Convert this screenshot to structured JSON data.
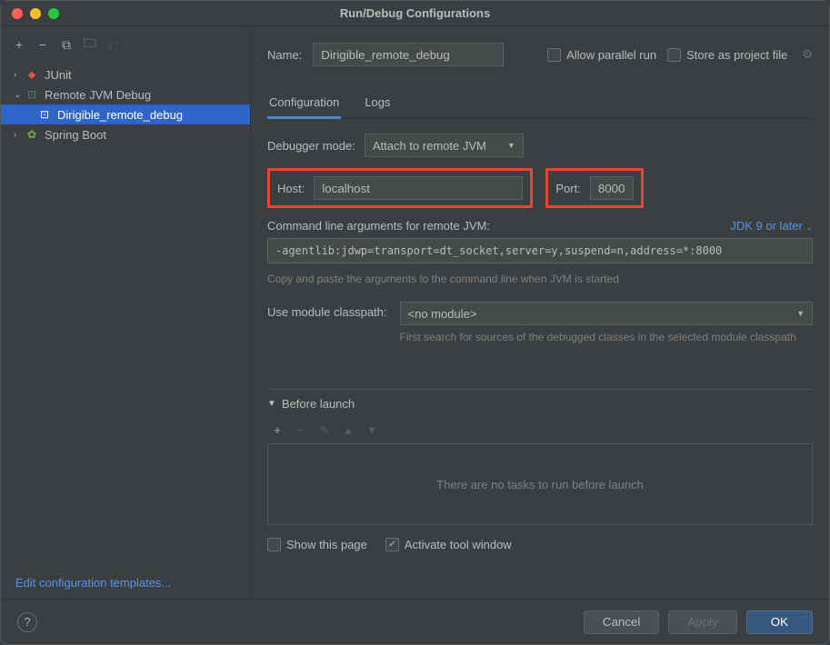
{
  "window": {
    "title": "Run/Debug Configurations"
  },
  "sidebar": {
    "items": [
      {
        "label": "JUnit",
        "expanded": false
      },
      {
        "label": "Remote JVM Debug",
        "expanded": true
      },
      {
        "label": "Dirigible_remote_debug"
      },
      {
        "label": "Spring Boot",
        "expanded": false
      }
    ],
    "edit_templates": "Edit configuration templates..."
  },
  "form": {
    "name_label": "Name:",
    "name_value": "Dirigible_remote_debug",
    "allow_parallel": "Allow parallel run",
    "store_project": "Store as project file",
    "tabs": {
      "configuration": "Configuration",
      "logs": "Logs"
    },
    "debugger_mode_label": "Debugger mode:",
    "debugger_mode_value": "Attach to remote JVM",
    "host_label": "Host:",
    "host_value": "localhost",
    "port_label": "Port:",
    "port_value": "8000",
    "cmd_label": "Command line arguments for remote JVM:",
    "jdk_label": "JDK 9 or later",
    "cmd_value": "-agentlib:jdwp=transport=dt_socket,server=y,suspend=n,address=*:8000",
    "cmd_hint": "Copy and paste the arguments to the command line when JVM is started",
    "classpath_label": "Use module classpath:",
    "classpath_value": "<no module>",
    "classpath_hint": "First search for sources of the debugged classes in the selected module classpath",
    "before_launch_label": "Before launch",
    "before_launch_empty": "There are no tasks to run before launch",
    "show_page": "Show this page",
    "activate_window": "Activate tool window"
  },
  "footer": {
    "cancel": "Cancel",
    "apply": "Apply",
    "ok": "OK"
  }
}
